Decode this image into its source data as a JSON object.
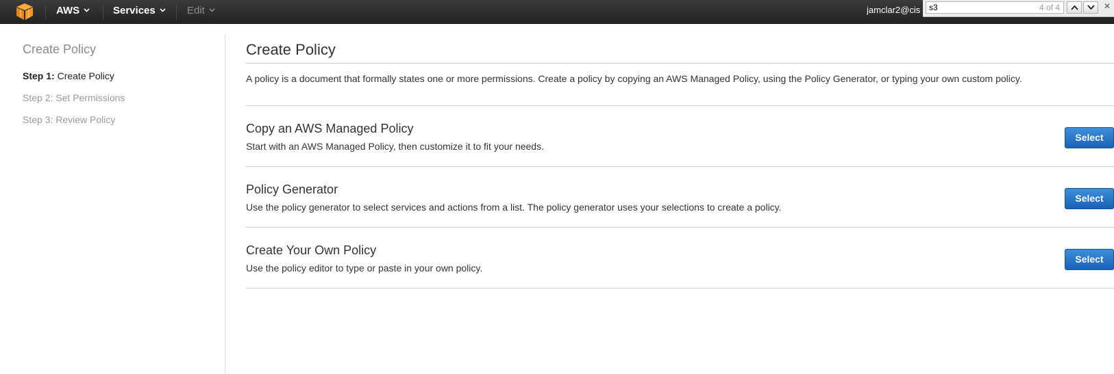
{
  "nav": {
    "brand": "AWS",
    "services": "Services",
    "edit": "Edit",
    "user": "jamclar2@cis"
  },
  "find": {
    "query": "s3",
    "count": "4 of 4"
  },
  "sidebar": {
    "title": "Create Policy",
    "steps": [
      {
        "number": "Step 1:",
        "label": "Create Policy"
      },
      {
        "number": "Step 2:",
        "label": "Set Permissions"
      },
      {
        "number": "Step 3:",
        "label": "Review Policy"
      }
    ]
  },
  "main": {
    "title": "Create Policy",
    "intro": "A policy is a document that formally states one or more permissions. Create a policy by copying an AWS Managed Policy, using the Policy Generator, or typing your own custom policy.",
    "options": [
      {
        "title": "Copy an AWS Managed Policy",
        "description": "Start with an AWS Managed Policy, then customize it to fit your needs.",
        "button": "Select"
      },
      {
        "title": "Policy Generator",
        "description": "Use the policy generator to select services and actions from a list. The policy generator uses your selections to create a policy.",
        "button": "Select"
      },
      {
        "title": "Create Your Own Policy",
        "description": "Use the policy editor to type or paste in your own policy.",
        "button": "Select"
      }
    ]
  },
  "colors": {
    "topbar": "#2b2b2b",
    "logo": "#f7981d",
    "button": "#1f6bbf"
  }
}
